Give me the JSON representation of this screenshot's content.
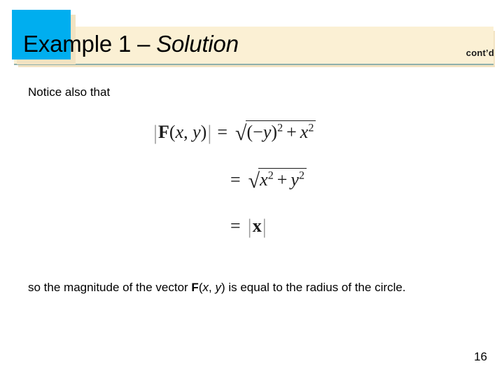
{
  "slide": {
    "page_number": "16",
    "background_color": "#ffffff"
  },
  "header": {
    "title_main": "Example 1 – ",
    "title_italic": "Solution",
    "continued_label": "cont’d",
    "accent_color": "#00aeef",
    "banner_color": "#fbf0d4",
    "banner_shadow_color": "#f2e3c2",
    "rule_color": "#8eb0ac"
  },
  "body": {
    "lead_text": "Notice also that",
    "closing_text_part1": "so the magnitude of the vector ",
    "closing_text_bold_f": "F",
    "closing_text_paren_open": "(",
    "closing_text_var_x": "x",
    "closing_text_comma": ", ",
    "closing_text_var_y": "y",
    "closing_text_paren_close": ")",
    "closing_text_part2": " is equal to the radius of the circle."
  },
  "equations": {
    "line1": {
      "bar_left": "|",
      "func": "F",
      "paren_open": "(",
      "var_x": "x",
      "comma": ", ",
      "var_y": "y",
      "paren_close": ")",
      "bar_right": "|",
      "equals": "=",
      "surd": "√",
      "radicand_open": "(",
      "minus": "−",
      "radicand_y": "y",
      "radicand_close": ")",
      "exp_a": "2",
      "plus": "+",
      "radicand_x": "x",
      "exp_b": "2"
    },
    "line2": {
      "equals": "=",
      "surd": "√",
      "var_x": "x",
      "exp_a": "2",
      "plus": "+",
      "var_y": "y",
      "exp_b": "2"
    },
    "line3": {
      "equals": "=",
      "bar_left": "|",
      "var_x": "x",
      "bar_right": "|"
    }
  }
}
